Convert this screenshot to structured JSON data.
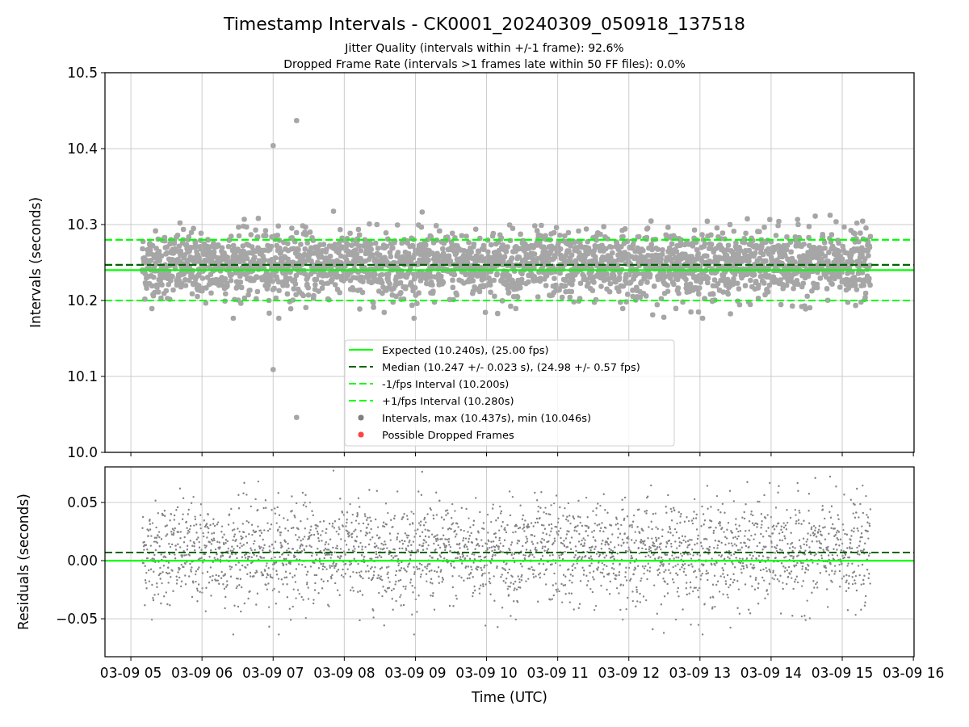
{
  "figure": {
    "title": "Timestamp Intervals - CK0001_20240309_050918_137518",
    "subtitles": [
      "Jitter Quality (intervals within +/-1 frame): 92.6%",
      "Dropped Frame Rate (intervals >1 frames late within 50 FF files): 0.0%"
    ]
  },
  "intervals_plot": {
    "chart_data": {
      "type": "scatter",
      "ylabel": "Intervals (seconds)",
      "ylim": [
        10.0,
        10.5
      ],
      "grid": true,
      "legend": "lower center",
      "categories": [
        null,
        null,
        null,
        null,
        null,
        null,
        null,
        null,
        null,
        null,
        null,
        null
      ],
      "yticks": [
        {
          "value": 10,
          "label": "10.0"
        },
        {
          "value": 10.1,
          "label": "10.1"
        },
        {
          "value": 10.2,
          "label": "10.2"
        },
        {
          "value": 10.3,
          "label": "10.3"
        },
        {
          "value": 10.4,
          "label": "10.4"
        },
        {
          "value": 10.5,
          "label": "10.5"
        }
      ],
      "ref_lines": [
        {
          "axis": "y",
          "value": 10.24,
          "label": "Expected (10.240s), (25.00 fps)",
          "color": "#00ff00"
        },
        {
          "axis": "y",
          "value": 10.247,
          "label": "Median (10.247 +/- 0.023 s), (24.98 +/- 0.57 fps)",
          "color": "#006400"
        },
        {
          "axis": "y",
          "value": 10.2,
          "label": "-1/fps Interval (10.200s)",
          "color": "#00ff00"
        },
        {
          "axis": "y",
          "value": 10.28,
          "label": "+1/fps Interval (10.280s)",
          "color": "#00ff00"
        }
      ]
    },
    "legend_markers": [
      {
        "label": "Intervals, max (10.437s), min (10.046s)",
        "color": "#808080"
      },
      {
        "label": "Possible Dropped Frames",
        "color": "#ff4444"
      }
    ]
  },
  "residuals_plot": {
    "chart_data": {
      "type": "scatter",
      "xlabel": "Time (UTC)",
      "ylabel": "Residuals (seconds)",
      "ylim": [
        -0.0826,
        0.0806
      ],
      "grid": true,
      "yticks": [
        {
          "value": -0.05,
          "label": "−0.05"
        },
        {
          "value": 0,
          "label": "0.00"
        },
        {
          "value": 0.05,
          "label": "0.05"
        }
      ],
      "categories": [
        "03-09 05",
        "03-09 06",
        "03-09 07",
        "03-09 08",
        "03-09 09",
        "03-09 10",
        "03-09 11",
        "03-09 12",
        "03-09 13",
        "03-09 14",
        "03-09 15",
        "03-09 16"
      ],
      "ref_lines": [
        {
          "axis": "y",
          "value": 0,
          "color": "#00ff00"
        },
        {
          "axis": "y",
          "value": 0.007,
          "color": "#006400"
        }
      ]
    }
  }
}
